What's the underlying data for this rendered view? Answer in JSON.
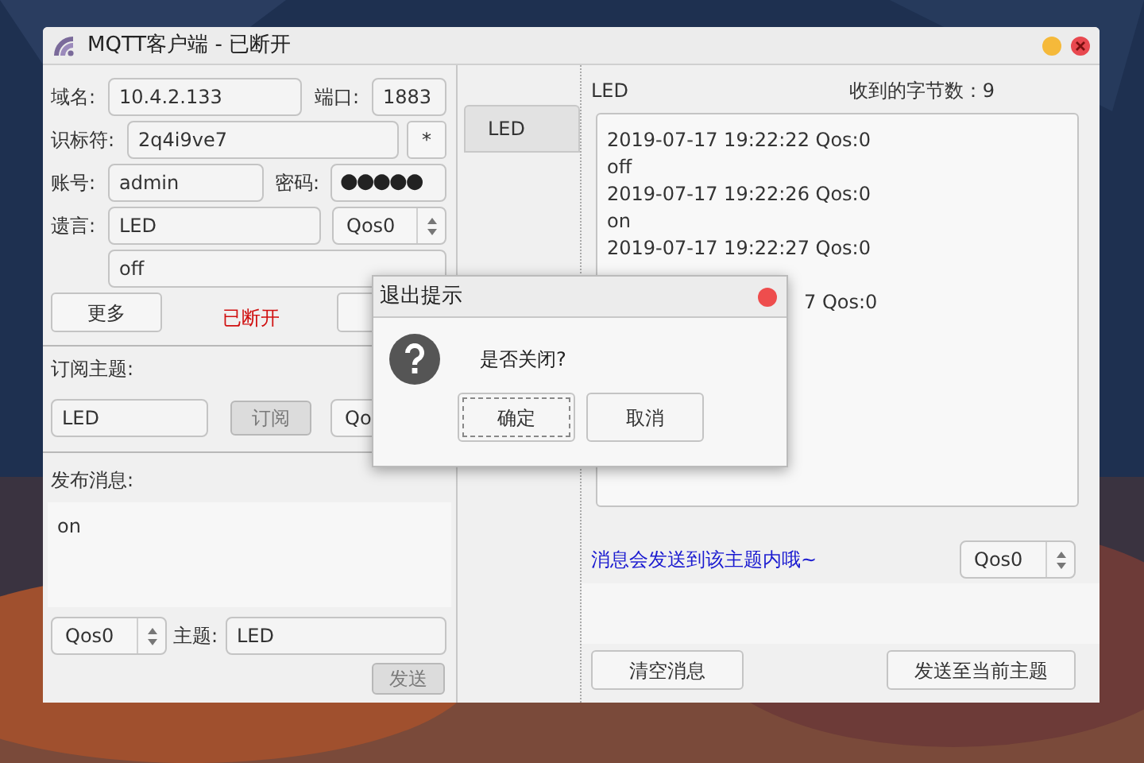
{
  "window": {
    "title": "MQTT客户端 - 已断开"
  },
  "connection": {
    "host_label": "域名:",
    "host": "10.4.2.133",
    "port_label": "端口:",
    "port": "1883",
    "client_id_label": "识标符:",
    "client_id": "2q4i9ve7",
    "client_id_button": "*",
    "username_label": "账号:",
    "username": "admin",
    "password_label": "密码:",
    "password_dots": "●●●●●",
    "will_label": "遗言:",
    "will_topic": "LED",
    "will_qos": "Qos0",
    "will_message": "off",
    "more_button": "更多",
    "status": "已断开"
  },
  "subscribe": {
    "label": "订阅主题:",
    "topic": "LED",
    "button": {
      "label": "订阅",
      "disabled": true
    },
    "qos": "Qo"
  },
  "publish": {
    "label": "发布消息:",
    "message": "on",
    "qos": "Qos0",
    "topic_label": "主题:",
    "topic": "LED",
    "send_button": {
      "label": "发送",
      "disabled": true
    }
  },
  "topic_tabs": [
    {
      "label": "LED",
      "selected": true
    }
  ],
  "messages": {
    "topic": "LED",
    "bytes_label": "收到的字节数：9",
    "log": [
      {
        "kind": "line",
        "text": "2019-07-17 19:22:22 Qos:0"
      },
      {
        "kind": "line",
        "text": "off"
      },
      {
        "kind": "line",
        "text": "2019-07-17 19:22:26 Qos:0"
      },
      {
        "kind": "line",
        "text": "on"
      },
      {
        "kind": "line",
        "text": "2019-07-17 19:22:27 Qos:0"
      },
      {
        "kind": "tail",
        "text": "7 Qos:0"
      }
    ],
    "hint": "消息会发送到该主题内哦~",
    "qos": "Qos0",
    "clear_button": "清空消息",
    "send_button": "发送至当前主题"
  },
  "dialog": {
    "title": "退出提示",
    "message": "是否关闭?",
    "buttons": [
      {
        "label": "确定",
        "focused": true
      },
      {
        "label": "取消",
        "focused": false
      }
    ]
  }
}
